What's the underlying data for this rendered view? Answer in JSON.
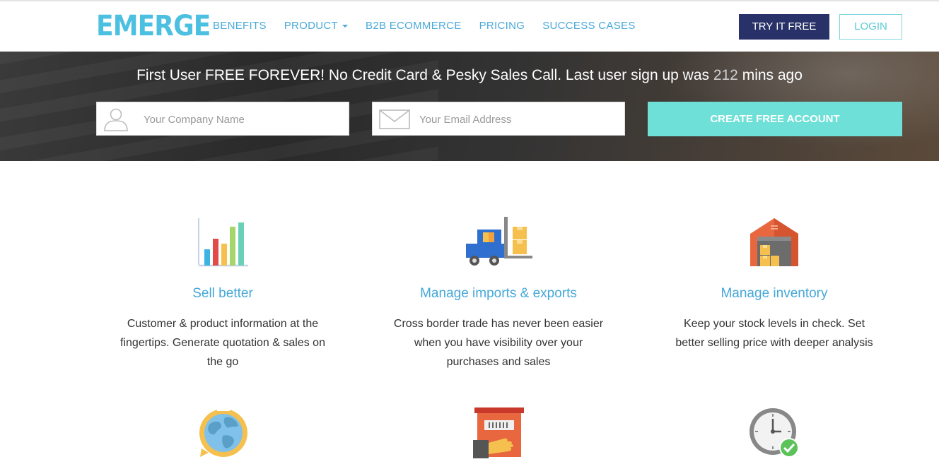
{
  "brand": {
    "logo": "EMERGE"
  },
  "nav": {
    "links": [
      "BENEFITS",
      "PRODUCT",
      "B2B ECOMMERCE",
      "PRICING",
      "SUCCESS CASES"
    ],
    "try_label": "TRY IT FREE",
    "login_label": "LOGIN"
  },
  "hero": {
    "title_before": "First User FREE FOREVER! No Credit Card & Pesky Sales Call. Last user sign up was ",
    "minutes": "212",
    "title_after": " mins ago",
    "company_placeholder": "Your Company Name",
    "email_placeholder": "Your Email Address",
    "cta_label": "CREATE FREE ACCOUNT"
  },
  "features": [
    {
      "title": "Sell better",
      "text": "Customer & product information at the fingertips. Generate quotation & sales on the go",
      "icon": "bar-chart-icon"
    },
    {
      "title": "Manage imports & exports",
      "text": "Cross border trade has never been easier when you have visibility over your purchases and sales",
      "icon": "forklift-icon"
    },
    {
      "title": "Manage inventory",
      "text": "Keep your stock levels in check. Set better selling price with deeper analysis",
      "icon": "warehouse-icon"
    },
    {
      "icon": "globe-chat-icon"
    },
    {
      "icon": "delivery-box-icon"
    },
    {
      "icon": "clock-check-icon"
    }
  ],
  "colors": {
    "accent": "#4aa9d9",
    "brand_dark": "#283268",
    "cta": "#6ee0d7"
  }
}
